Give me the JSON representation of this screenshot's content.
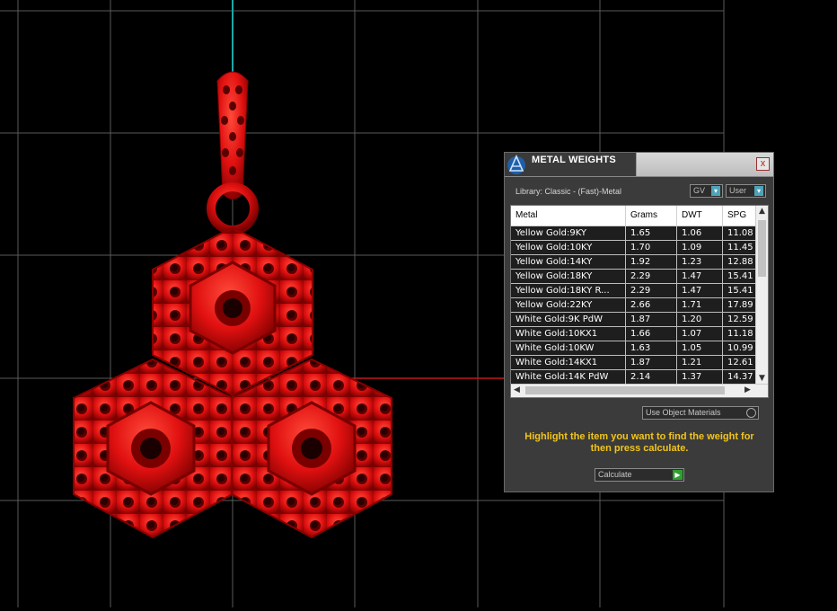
{
  "colors": {
    "background": "#000000",
    "grid": "#5a5a5a",
    "axis_vertical": "#1aa7a7",
    "axis_horizontal": "#c01818",
    "model": "#e01010",
    "accent_text": "#f2c51a"
  },
  "panel": {
    "title": "METAL WEIGHTS",
    "close_label": "x",
    "library_label": "Library: Classic - (Fast)-Metal",
    "gv_label": "GV",
    "user_label": "User",
    "columns": [
      "Metal",
      "Grams",
      "DWT",
      "SPG"
    ],
    "rows": [
      [
        "Yellow Gold:9KY",
        "1.65",
        "1.06",
        "11.08"
      ],
      [
        "Yellow Gold:10KY",
        "1.70",
        "1.09",
        "11.45"
      ],
      [
        "Yellow Gold:14KY",
        "1.92",
        "1.23",
        "12.88"
      ],
      [
        "Yellow Gold:18KY",
        "2.29",
        "1.47",
        "15.41"
      ],
      [
        "Yellow Gold:18KY R...",
        "2.29",
        "1.47",
        "15.41"
      ],
      [
        "Yellow Gold:22KY",
        "2.66",
        "1.71",
        "17.89"
      ],
      [
        "White Gold:9K PdW",
        "1.87",
        "1.20",
        "12.59"
      ],
      [
        "White Gold:10KX1",
        "1.66",
        "1.07",
        "11.18"
      ],
      [
        "White Gold:10KW",
        "1.63",
        "1.05",
        "10.99"
      ],
      [
        "White Gold:14KX1",
        "1.87",
        "1.21",
        "12.61"
      ],
      [
        "White Gold:14K PdW",
        "2.14",
        "1.37",
        "14.37"
      ]
    ],
    "use_object_materials_label": "Use Object Materials",
    "instructions": "Highlight the item you want to find the weight for then press calculate.",
    "calculate_label": "Calculate"
  }
}
